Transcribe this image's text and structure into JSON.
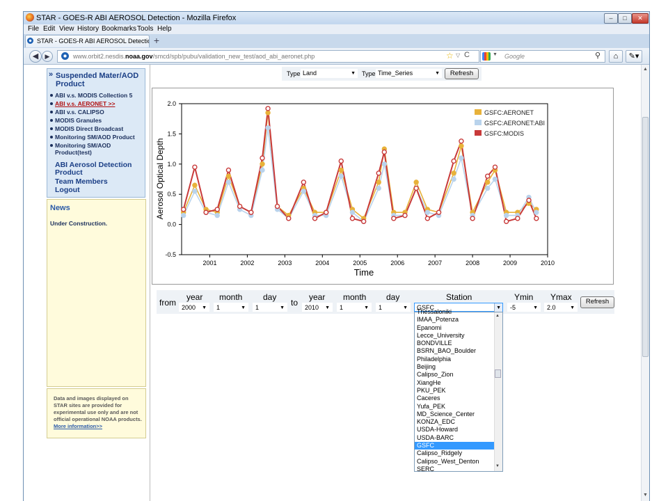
{
  "window": {
    "title": "STAR - GOES-R ABI AEROSOL Detection - Mozilla Firefox",
    "controls": [
      "–",
      "□",
      "✕"
    ]
  },
  "menu": [
    "File",
    "Edit",
    "View",
    "History",
    "Bookmarks",
    "Tools",
    "Help"
  ],
  "tab": {
    "label": "STAR - GOES-R ABI AEROSOL Detection",
    "new_tab": "+"
  },
  "address": {
    "url_prefix": "www.orbit2.nesdis.",
    "url_bold": "noaa.gov",
    "url_suffix": "/smcd/spb/pubu/validation_new_test/aod_abi_aeronet.php",
    "search_placeholder": "Google"
  },
  "sidebar": {
    "heading": "Suspended Mater/AOD Product",
    "links": [
      {
        "label": "ABI v.s. MODIS Collection 5",
        "active": false
      },
      {
        "label": "ABI v.s. AERONET >>",
        "active": true
      },
      {
        "label": "ABI v.s. CALIPSO",
        "active": false
      },
      {
        "label": "MODIS Granules",
        "active": false
      },
      {
        "label": "MODIS Direct Broadcast",
        "active": false
      },
      {
        "label": "Monitoring SM/AOD Product",
        "active": false
      },
      {
        "label": "Monitoring SM/AOD Product(test)",
        "active": false
      }
    ],
    "big_links": [
      "ABI Aerosol Detection Product",
      "Team Members",
      "Logout"
    ],
    "news_title": "News",
    "news_text": "Under Construction.",
    "disclaimer": "Data and images displayed on STAR sites are provided for experimental use only and are not official operational NOAA products.",
    "more_info": "More information>>"
  },
  "type_bar": {
    "type_label": "Type",
    "type1": "Land",
    "type2_label": "Type",
    "type2": "Time_Series",
    "refresh": "Refresh"
  },
  "form": {
    "from": "from",
    "to": "to",
    "headers": [
      "year",
      "month",
      "day",
      "year",
      "month",
      "day",
      "Station",
      "Ymin",
      "Ymax"
    ],
    "values": [
      "2000",
      "1",
      "1",
      "2010",
      "1",
      "1",
      "GSFC",
      "-5",
      "2.0"
    ],
    "refresh": "Refresh"
  },
  "station_dropdown": {
    "options": [
      "Thessaloniki",
      "IMAA_Potenza",
      "Epanomi",
      "Lecce_University",
      "BONDVILLE",
      "BSRN_BAO_Boulder",
      "Philadelphia",
      "Beijing",
      "Calipso_Zion",
      "XiangHe",
      "PKU_PEK",
      "Caceres",
      "Yufa_PEK",
      "MD_Science_Center",
      "KONZA_EDC",
      "USDA-Howard",
      "USDA-BARC",
      "GSFC",
      "Calipso_Ridgely",
      "Calipso_West_Denton",
      "SERC"
    ],
    "selected": "GSFC"
  },
  "colors": {
    "aeronet": "#e8b23a",
    "aeronet_abi": "#b9d3ec",
    "modis": "#c83a3a"
  },
  "chart_data": {
    "type": "line",
    "title": "",
    "xlabel": "Time",
    "ylabel": "Aerosol Optical Depth",
    "xlim": [
      2000.25,
      2010.0
    ],
    "ylim": [
      -0.5,
      2.0
    ],
    "x_ticks": [
      "2001",
      "2002",
      "2003",
      "2004",
      "2005",
      "2006",
      "2007",
      "2008",
      "2009",
      "2010"
    ],
    "y_ticks": [
      "2.0",
      "1.5",
      "1.0",
      "0.5",
      "0.0",
      "-0.5"
    ],
    "legend_position": "top-right",
    "series": [
      {
        "name": "GSFC:AERONET",
        "x": [
          2000.3,
          2000.6,
          2000.9,
          2001.2,
          2001.5,
          2001.8,
          2002.1,
          2002.4,
          2002.55,
          2002.8,
          2003.1,
          2003.5,
          2003.8,
          2004.1,
          2004.5,
          2004.8,
          2005.1,
          2005.5,
          2005.65,
          2005.9,
          2006.2,
          2006.5,
          2006.8,
          2007.1,
          2007.5,
          2007.7,
          2008.0,
          2008.4,
          2008.6,
          2008.9,
          2009.2,
          2009.5,
          2009.7
        ],
        "y": [
          0.2,
          0.65,
          0.25,
          0.2,
          0.8,
          0.3,
          0.2,
          1.0,
          1.85,
          0.3,
          0.15,
          0.6,
          0.2,
          0.2,
          0.9,
          0.25,
          0.1,
          0.7,
          1.25,
          0.2,
          0.2,
          0.7,
          0.25,
          0.2,
          0.85,
          1.3,
          0.2,
          0.7,
          0.9,
          0.2,
          0.2,
          0.35,
          0.25
        ]
      },
      {
        "name": "GSFC:AERONET:ABI",
        "x": [
          2000.3,
          2000.6,
          2000.9,
          2001.2,
          2001.5,
          2001.8,
          2002.1,
          2002.4,
          2002.55,
          2002.8,
          2003.1,
          2003.5,
          2003.8,
          2004.1,
          2004.5,
          2004.8,
          2005.1,
          2005.5,
          2005.65,
          2005.9,
          2006.2,
          2006.5,
          2006.8,
          2007.1,
          2007.5,
          2007.7,
          2008.0,
          2008.4,
          2008.6,
          2008.9,
          2009.2,
          2009.5,
          2009.7
        ],
        "y": [
          0.15,
          0.55,
          0.2,
          0.15,
          0.7,
          0.25,
          0.15,
          0.9,
          1.6,
          0.25,
          0.1,
          0.55,
          0.15,
          0.15,
          0.8,
          0.2,
          0.05,
          0.6,
          1.0,
          0.15,
          0.15,
          0.6,
          0.2,
          0.15,
          0.75,
          1.1,
          0.15,
          0.6,
          0.75,
          0.15,
          0.15,
          0.45,
          0.2
        ]
      },
      {
        "name": "GSFC:MODIS",
        "x": [
          2000.3,
          2000.6,
          2000.9,
          2001.2,
          2001.5,
          2001.8,
          2002.1,
          2002.4,
          2002.55,
          2002.8,
          2003.1,
          2003.5,
          2003.8,
          2004.1,
          2004.5,
          2004.8,
          2005.1,
          2005.5,
          2005.65,
          2005.9,
          2006.2,
          2006.5,
          2006.8,
          2007.1,
          2007.5,
          2007.7,
          2008.0,
          2008.4,
          2008.6,
          2008.9,
          2009.2,
          2009.5,
          2009.7
        ],
        "y": [
          0.25,
          0.95,
          0.2,
          0.25,
          0.9,
          0.3,
          0.2,
          1.1,
          1.92,
          0.3,
          0.1,
          0.7,
          0.1,
          0.2,
          1.05,
          0.1,
          0.05,
          0.85,
          1.2,
          0.1,
          0.15,
          0.6,
          0.1,
          0.2,
          1.05,
          1.38,
          0.1,
          0.8,
          0.95,
          0.05,
          0.1,
          0.4,
          0.1
        ]
      }
    ]
  }
}
